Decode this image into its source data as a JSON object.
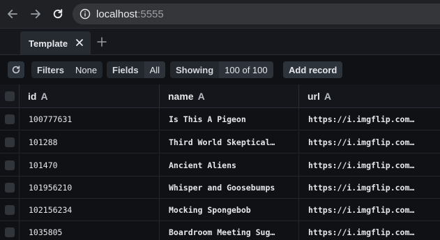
{
  "browser": {
    "url_host": "localhost",
    "url_port": ":5555"
  },
  "tabs": [
    {
      "label": "Template"
    }
  ],
  "toolbar": {
    "filters_label": "Filters",
    "filters_value": "None",
    "fields_label": "Fields",
    "fields_value": "All",
    "showing_label": "Showing",
    "showing_value": "100 of 100",
    "add_record_label": "Add record"
  },
  "table": {
    "columns": [
      {
        "name": "id",
        "type_glyph": "A"
      },
      {
        "name": "name",
        "type_glyph": "A"
      },
      {
        "name": "url",
        "type_glyph": "A"
      }
    ],
    "rows": [
      {
        "id": "100777631",
        "name": "Is This A Pigeon",
        "url": "https://i.imgflip.com…"
      },
      {
        "id": "101288",
        "name": "Third World Skeptical…",
        "url": "https://i.imgflip.com…"
      },
      {
        "id": "101470",
        "name": "Ancient Aliens",
        "url": "https://i.imgflip.com…"
      },
      {
        "id": "101956210",
        "name": "Whisper and Goosebumps",
        "url": "https://i.imgflip.com…"
      },
      {
        "id": "102156234",
        "name": "Mocking Spongebob",
        "url": "https://i.imgflip.com…"
      },
      {
        "id": "1035805",
        "name": "Boardroom Meeting Sug…",
        "url": "https://i.imgflip.com…"
      }
    ]
  },
  "colors": {
    "background": "#0f1115",
    "chrome": "#202124",
    "pill": "#23272e"
  },
  "icons": [
    "back-icon",
    "forward-icon",
    "reload-icon",
    "info-icon",
    "close-icon",
    "plus-icon",
    "refresh-icon"
  ]
}
